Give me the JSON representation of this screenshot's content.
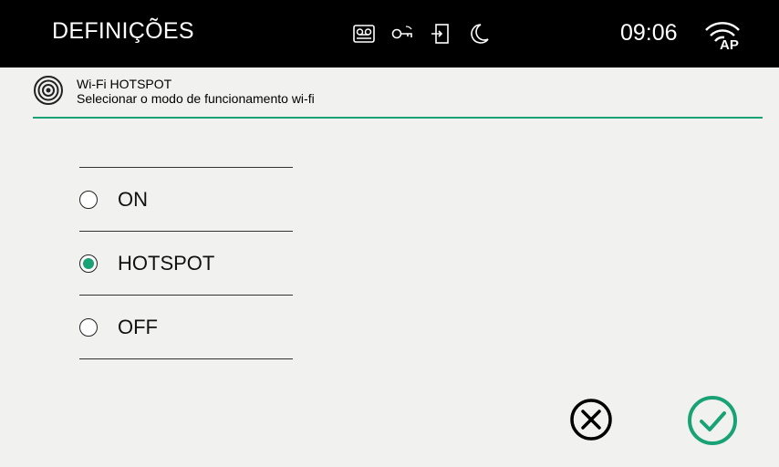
{
  "topbar": {
    "title": "DEFINIÇÕES",
    "clock": "09:06",
    "status_icons": [
      "voicemail-icon",
      "key-icon",
      "door-exit-icon",
      "moon-icon"
    ],
    "network_icon": "wifi-ap-icon",
    "network_label": "AP"
  },
  "header": {
    "icon": "wifi-hotspot-icon",
    "title": "Wi-Fi HOTSPOT",
    "subtitle": "Selecionar o modo de funcionamento wi-fi"
  },
  "options": [
    {
      "label": "ON",
      "selected": false
    },
    {
      "label": "HOTSPOT",
      "selected": true
    },
    {
      "label": "OFF",
      "selected": false
    }
  ],
  "actions": {
    "cancel_icon": "cancel-icon",
    "confirm_icon": "confirm-icon"
  },
  "colors": {
    "accent": "#1aa277",
    "topbar_bg": "#000000",
    "background": "#f1f1ef"
  }
}
